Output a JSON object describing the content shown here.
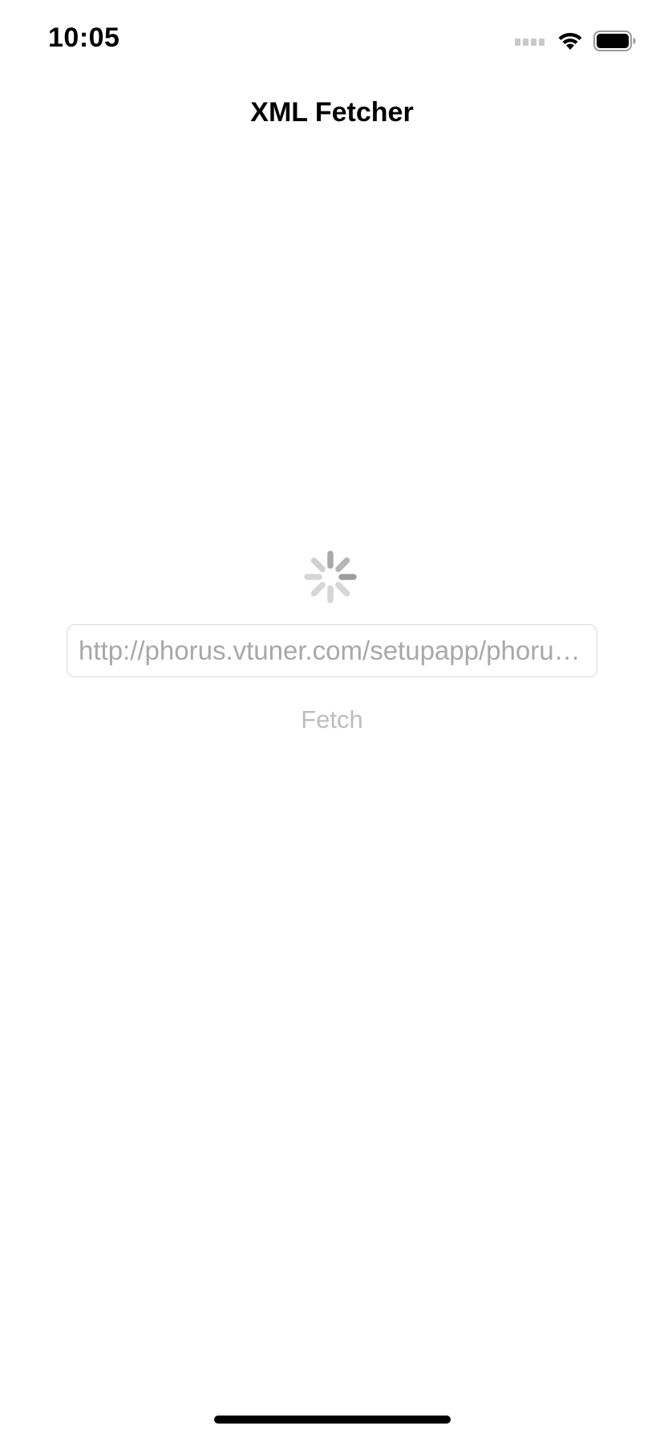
{
  "status_bar": {
    "time": "10:05",
    "icons": [
      "cellular-signal-icon",
      "wifi-icon",
      "battery-icon"
    ]
  },
  "nav": {
    "title": "XML Fetcher"
  },
  "loading": {
    "indicator": "activity-spinner-icon"
  },
  "url_field": {
    "value": "http://phorus.vtuner.com/setupapp/phorus/asp/browsexml/navXML.asp"
  },
  "fetch_button": {
    "label": "Fetch",
    "enabled": false
  },
  "colors": {
    "background": "#ffffff",
    "title_text": "#000000",
    "field_text": "#a8a8a8",
    "field_border": "#d9d9d9",
    "disabled_button": "#bdbdbd"
  }
}
